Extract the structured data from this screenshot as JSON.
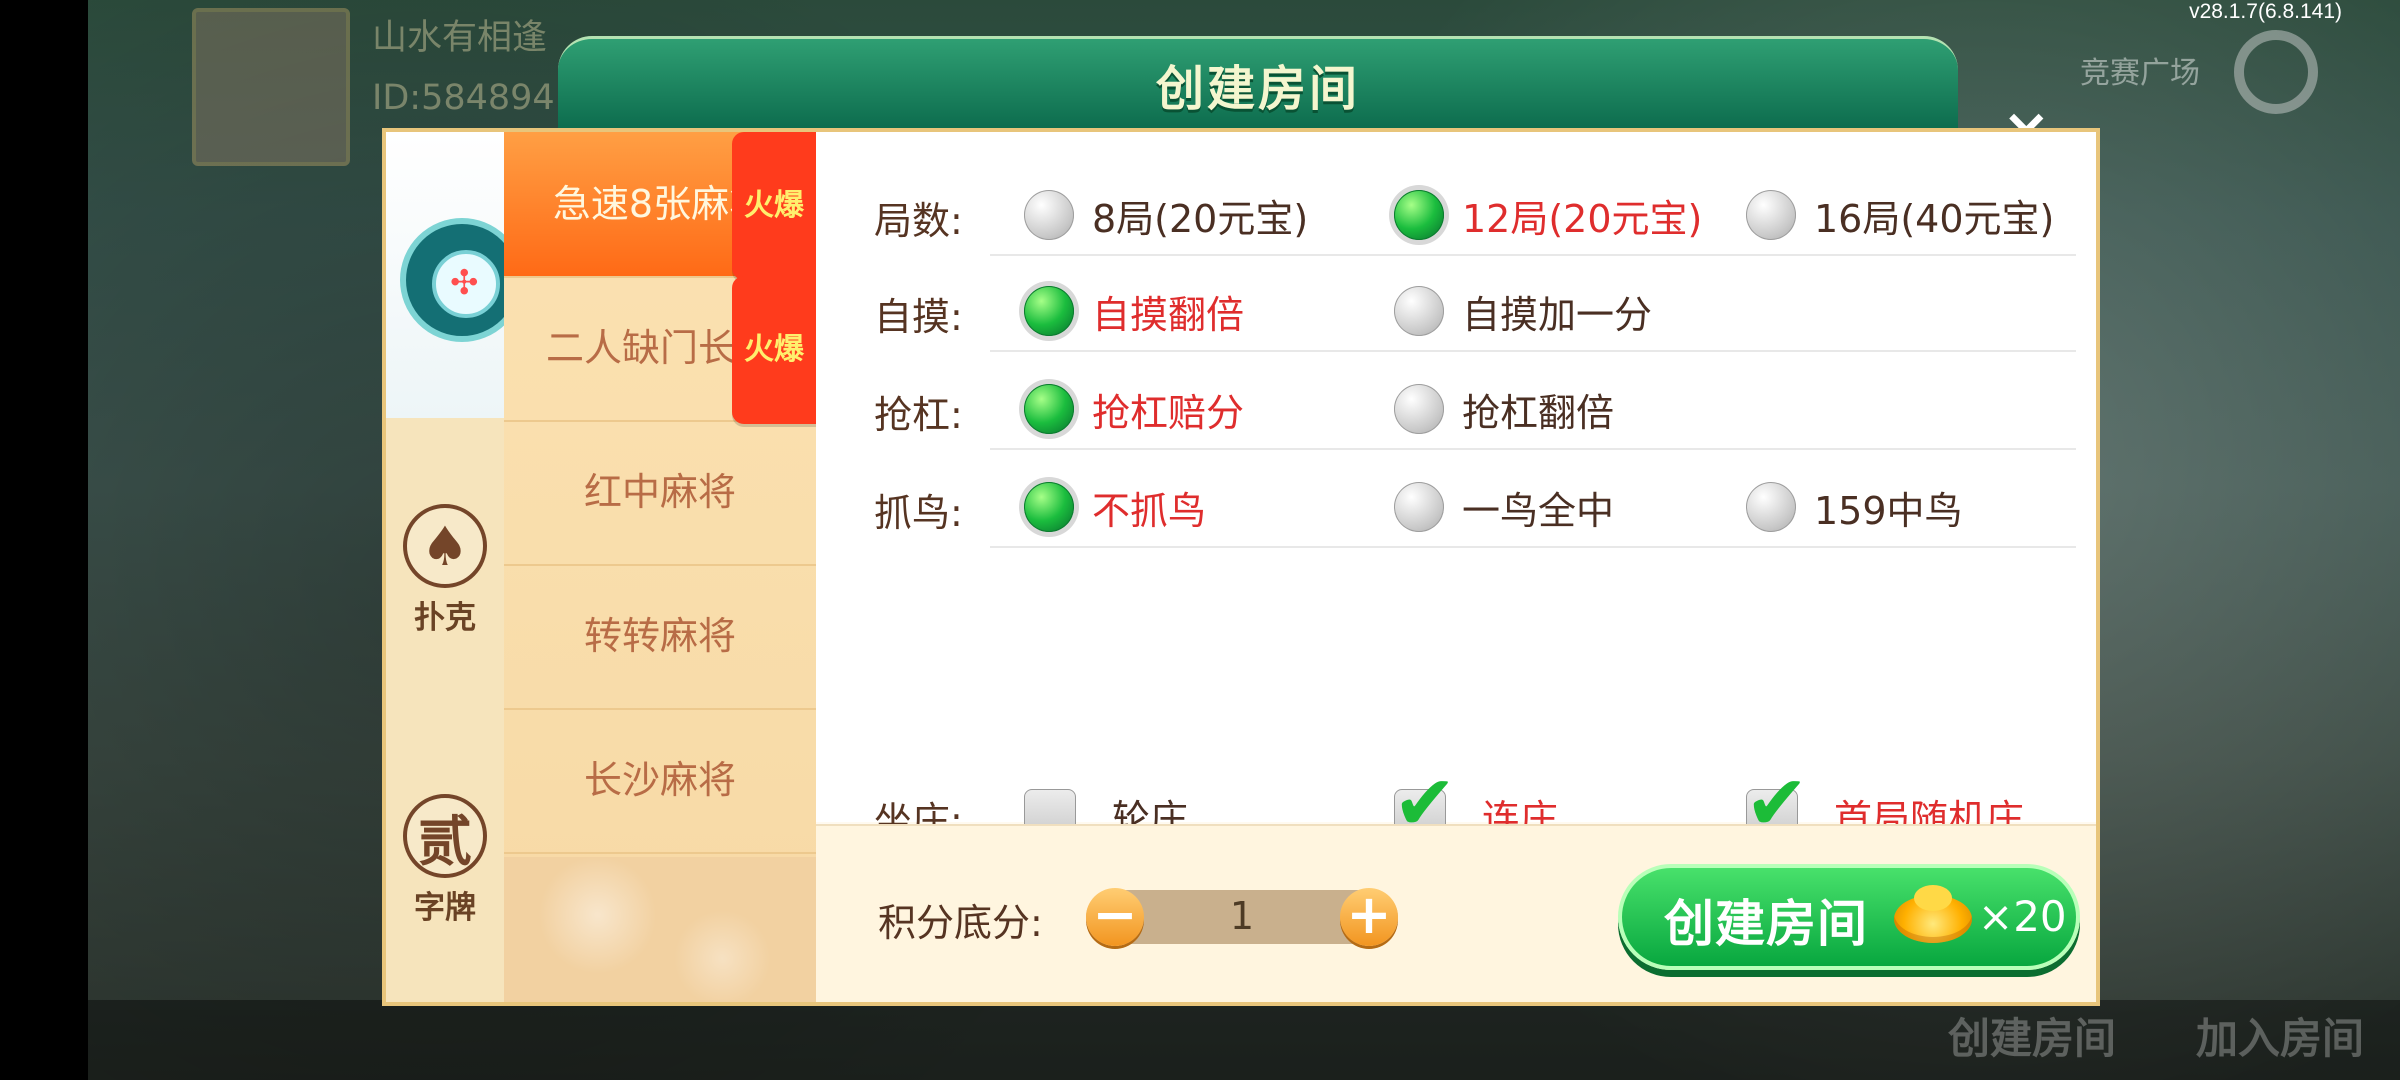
{
  "system": {
    "version": "v28.1.7(6.8.141)"
  },
  "background": {
    "user_name": "山水有相逢",
    "user_id": "ID:584894",
    "top_right": "竞赛广场",
    "create_room": "创建房间",
    "join_room": "加入房间"
  },
  "dialog": {
    "title": "创建房间",
    "close": "×"
  },
  "left_categories": [
    {
      "label": "扑克",
      "icon": "spade-icon"
    },
    {
      "label": "字牌",
      "icon": "char-icon"
    }
  ],
  "games": [
    {
      "label": "急速8张麻将",
      "badge": "火爆"
    },
    {
      "label": "二人缺门长麻",
      "badge": "火爆"
    },
    {
      "label": "红中麻将"
    },
    {
      "label": "转转麻将"
    },
    {
      "label": "长沙麻将"
    }
  ],
  "options": {
    "rounds": {
      "label": "局数:",
      "items": [
        {
          "text": "8局(20元宝)"
        },
        {
          "text": "12局(20元宝)"
        },
        {
          "text": "16局(40元宝)"
        }
      ]
    },
    "zimo": {
      "label": "自摸:",
      "items": [
        {
          "text": "自摸翻倍"
        },
        {
          "text": "自摸加一分"
        }
      ]
    },
    "qianggang": {
      "label": "抢杠:",
      "items": [
        {
          "text": "抢杠赔分"
        },
        {
          "text": "抢杠翻倍"
        }
      ]
    },
    "zhuaniao": {
      "label": "抓鸟:",
      "items": [
        {
          "text": "不抓鸟"
        },
        {
          "text": "一鸟全中"
        },
        {
          "text": "159中鸟"
        }
      ]
    },
    "zuozhuang": {
      "label": "坐庄:",
      "items": [
        {
          "text": "轮庄"
        },
        {
          "text": "连庄"
        },
        {
          "text": "首局随机庄"
        }
      ]
    }
  },
  "bottom": {
    "score_label": "积分底分:",
    "minus": "−",
    "value": "1",
    "plus": "+",
    "create_button": "创建房间",
    "cost": "×20"
  },
  "colors": {
    "header_green": "#0c6b4d",
    "accent_orange": "#ff6a16",
    "selected_green": "#1bbd3e",
    "selected_text_red": "#df2d2d"
  }
}
